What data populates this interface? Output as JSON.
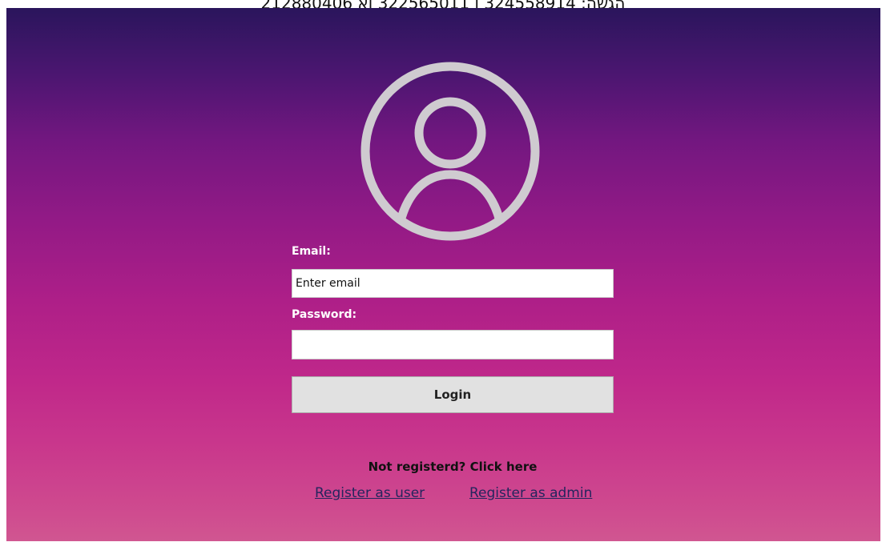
{
  "window": {
    "title": "הגשה: 324558914 ו 322565011 וא 212880406"
  },
  "colors": {
    "background_top": "#2a155c",
    "background_bottom": "#d05691",
    "avatar_stroke": "#cfcbd0"
  },
  "avatar": {
    "icon": "user-circle-icon"
  },
  "form": {
    "email_label": "Email:",
    "email_placeholder": "Enter email",
    "email_value": "",
    "password_label": "Password:",
    "password_value": "",
    "login_label": "Login"
  },
  "register": {
    "prompt": "Not registerd? Click here",
    "as_user": "Register as user",
    "as_admin": "Register as admin"
  }
}
